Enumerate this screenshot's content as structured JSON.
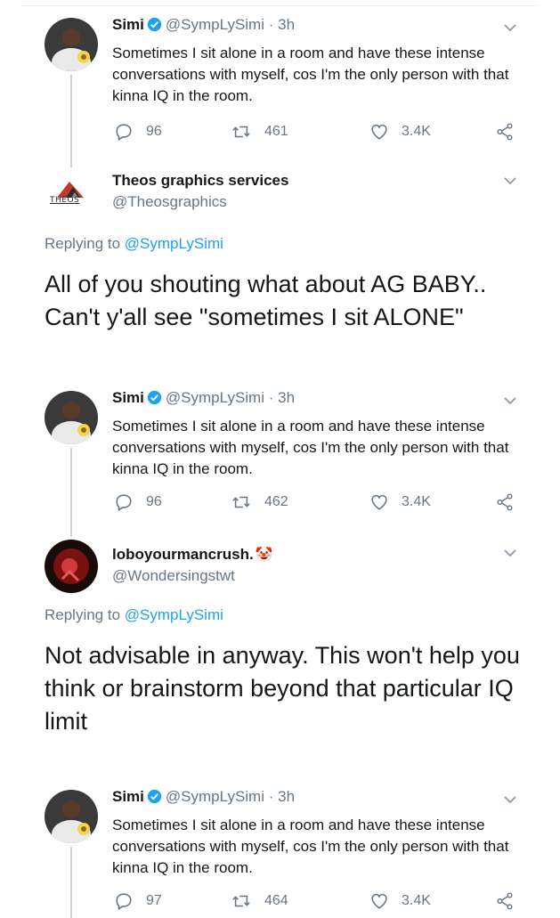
{
  "tweets": [
    {
      "name": "Simi",
      "handle": "@SympLySimi",
      "time": "· 3h",
      "text": "Sometimes I sit alone in a room and have these intense conversations with myself, cos I'm the only person with that kinna IQ in the room.",
      "replies": "96",
      "retweets": "461",
      "likes": "3.4K"
    },
    {
      "name": "Simi",
      "handle": "@SympLySimi",
      "time": "· 3h",
      "text": "Sometimes I sit alone in a room and have these intense conversations with myself, cos I'm the only person with that kinna IQ in the room.",
      "replies": "96",
      "retweets": "462",
      "likes": "3.4K"
    },
    {
      "name": "Simi",
      "handle": "@SympLySimi",
      "time": "· 3h",
      "text": "Sometimes I sit alone in a room and have these intense conversations with myself, cos I'm the only person with that kinna IQ in the room.",
      "replies": "97",
      "retweets": "464",
      "likes": "3.4K"
    }
  ],
  "replies": [
    {
      "name": "Theos graphics services",
      "handle": "@Theosgraphics",
      "replying_prefix": "Replying to",
      "replying_to": "@SympLySimi",
      "text": "All of you shouting what about AG BABY.. Can't y'all see \"sometimes I sit ALONE\"",
      "avatar_label": "THEOS"
    },
    {
      "name": "loboyourmancrush.",
      "handle": "@Wondersingstwt",
      "replying_prefix": "Replying to",
      "replying_to": "@SympLySimi",
      "text": "Not advisable in anyway. This won't help you think or brainstorm beyond that particular IQ limit",
      "emoji": "🤡"
    }
  ],
  "icons": {
    "reply": "reply-icon",
    "retweet": "retweet-icon",
    "like": "heart-icon",
    "share": "share-icon",
    "more": "chevron-down-icon",
    "verified": "verified-badge-icon"
  },
  "colors": {
    "text": "#14171a",
    "secondary": "#657786",
    "link": "#1da1f2",
    "verified": "#1da1f2",
    "thread": "#ccd6dd"
  }
}
